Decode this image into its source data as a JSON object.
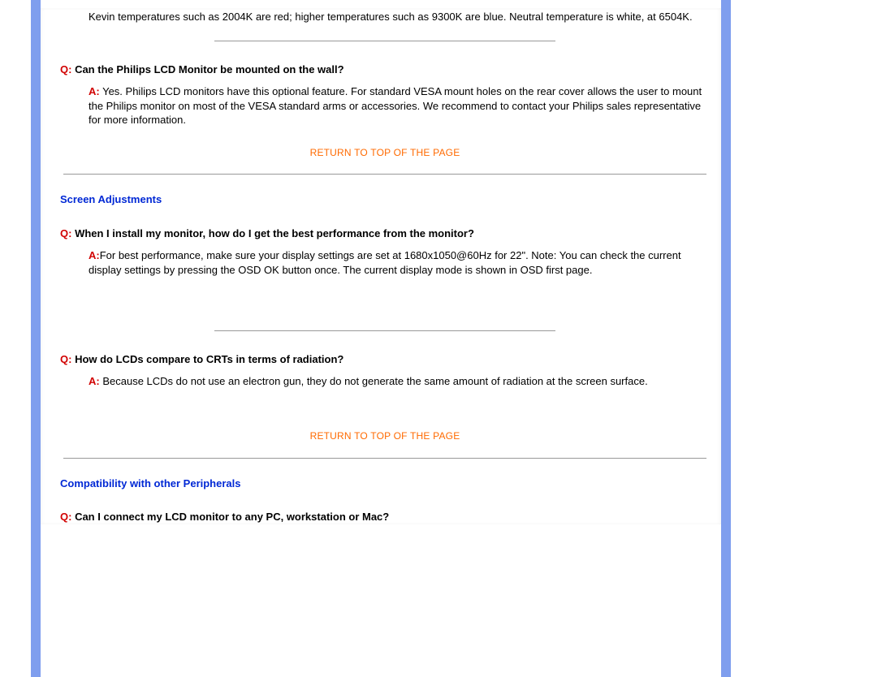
{
  "intro_answer": "Kevin temperatures such as 2004K are red; higher temperatures such as 9300K are blue. Neutral temperature is white, at 6504K.",
  "q_prefix": "Q:",
  "a_prefix": "A:",
  "return_link": "RETURN TO TOP OF THE PAGE",
  "q1": {
    "q": " Can the Philips LCD Monitor be mounted on the wall?",
    "a": " Yes. Philips LCD monitors have this optional feature. For standard VESA mount holes on the rear cover allows the user to mount the Philips monitor on most of the VESA standard arms or accessories. We recommend to contact your Philips sales representative for more information."
  },
  "section2": "Screen Adjustments",
  "q2": {
    "q": " When I install my monitor, how do I get the best performance from the monitor?",
    "a": "For best performance, make sure your display settings are set at 1680x1050@60Hz for 22\". Note: You can check the current display settings by pressing the OSD OK button once. The current display mode is shown in OSD first page."
  },
  "q3": {
    "q": " How do LCDs compare to CRTs in terms of radiation?",
    "a": " Because LCDs do not use an electron gun, they do not generate the same amount of radiation at the screen surface."
  },
  "section3": "Compatibility with other Peripherals",
  "q4": {
    "q": " Can I connect my LCD monitor to any PC, workstation or Mac?"
  }
}
